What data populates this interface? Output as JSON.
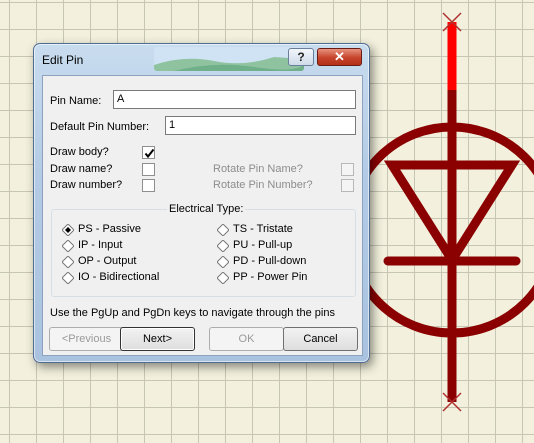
{
  "dialog": {
    "title": "Edit Pin",
    "help_label": "?",
    "close_label": "✕"
  },
  "fields": {
    "pin_name_label": "Pin Name:",
    "pin_name_value": "A",
    "default_pin_number_label": "Default Pin Number:",
    "default_pin_number_value": "1"
  },
  "checkboxes": {
    "draw_body": {
      "label": "Draw body?",
      "checked": true
    },
    "draw_name": {
      "label": "Draw name?",
      "checked": false
    },
    "draw_number": {
      "label": "Draw number?",
      "checked": false
    },
    "rotate_pin_name": {
      "label": "Rotate Pin Name?",
      "checked": false,
      "disabled": true
    },
    "rotate_pin_number": {
      "label": "Rotate Pin Number?",
      "checked": false,
      "disabled": true
    }
  },
  "electrical_type": {
    "title": "Electrical Type:",
    "selected": "PS - Passive",
    "options": [
      "PS - Passive",
      "IP - Input",
      "OP - Output",
      "IO - Bidirectional",
      "TS - Tristate",
      "PU - Pull-up",
      "PD - Pull-down",
      "PP - Power Pin"
    ]
  },
  "hint": "Use the PgUp and PgDn keys to navigate through the pins",
  "buttons": {
    "previous": "<Previous",
    "next": "Next>",
    "ok": "OK",
    "cancel": "Cancel"
  },
  "colors": {
    "schematic_line": "#8b0000",
    "selected_pin": "#ff0000",
    "grid_line": "#c6c6b4",
    "background": "#f3f1dd"
  }
}
